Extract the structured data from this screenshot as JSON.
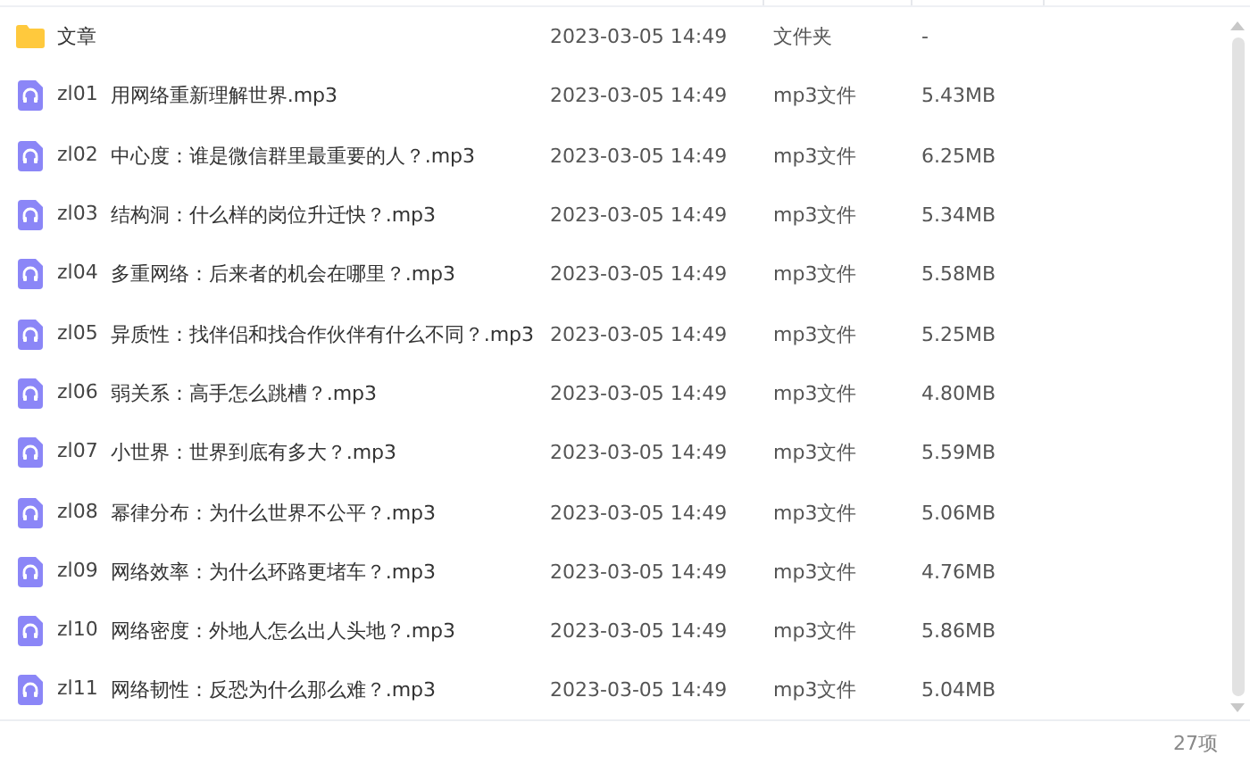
{
  "files": [
    {
      "kind": "folder",
      "name": "文章",
      "modified": "2023-03-05 14:49",
      "type": "文件夹",
      "size": "-"
    },
    {
      "kind": "audio",
      "code": "zl01",
      "name": "用网络重新理解世界.mp3",
      "modified": "2023-03-05 14:49",
      "type": "mp3文件",
      "size": "5.43MB"
    },
    {
      "kind": "audio",
      "code": "zl02",
      "name": "中心度：谁是微信群里最重要的人？.mp3",
      "modified": "2023-03-05 14:49",
      "type": "mp3文件",
      "size": "6.25MB"
    },
    {
      "kind": "audio",
      "code": "zl03",
      "name": "结构洞：什么样的岗位升迁快？.mp3",
      "modified": "2023-03-05 14:49",
      "type": "mp3文件",
      "size": "5.34MB"
    },
    {
      "kind": "audio",
      "code": "zl04",
      "name": "多重网络：后来者的机会在哪里？.mp3",
      "modified": "2023-03-05 14:49",
      "type": "mp3文件",
      "size": "5.58MB"
    },
    {
      "kind": "audio",
      "code": "zl05",
      "name": "异质性：找伴侣和找合作伙伴有什么不同？.mp3",
      "modified": "2023-03-05 14:49",
      "type": "mp3文件",
      "size": "5.25MB"
    },
    {
      "kind": "audio",
      "code": "zl06",
      "name": "弱关系：高手怎么跳槽？.mp3",
      "modified": "2023-03-05 14:49",
      "type": "mp3文件",
      "size": "4.80MB"
    },
    {
      "kind": "audio",
      "code": "zl07",
      "name": "小世界：世界到底有多大？.mp3",
      "modified": "2023-03-05 14:49",
      "type": "mp3文件",
      "size": "5.59MB"
    },
    {
      "kind": "audio",
      "code": "zl08",
      "name": "幂律分布：为什么世界不公平？.mp3",
      "modified": "2023-03-05 14:49",
      "type": "mp3文件",
      "size": "5.06MB"
    },
    {
      "kind": "audio",
      "code": "zl09",
      "name": "网络效率：为什么环路更堵车？.mp3",
      "modified": "2023-03-05 14:49",
      "type": "mp3文件",
      "size": "4.76MB"
    },
    {
      "kind": "audio",
      "code": "zl10",
      "name": "网络密度：外地人怎么出人头地？.mp3",
      "modified": "2023-03-05 14:49",
      "type": "mp3文件",
      "size": "5.86MB"
    },
    {
      "kind": "audio",
      "code": "zl11",
      "name": "网络韧性：反恐为什么那么难？.mp3",
      "modified": "2023-03-05 14:49",
      "type": "mp3文件",
      "size": "5.04MB"
    }
  ],
  "status_bar": {
    "count": "27项"
  }
}
